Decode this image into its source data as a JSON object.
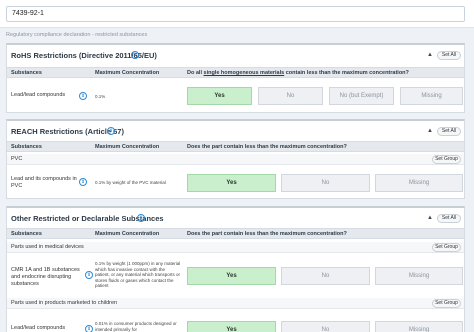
{
  "search": {
    "value": "7439-92-1"
  },
  "breadcrumb": "Regulatory compliance declaration - restricted substances",
  "rohs": {
    "title": "RoHS Restrictions (Directive 2011/65/EU)",
    "set_all": "Set All",
    "headers": {
      "substances": "Substances",
      "max_conc": "Maximum Concentration",
      "question_pre": "Do all ",
      "question_link": "single homogeneous materials",
      "question_post": " contain less than the maximum concentration?"
    },
    "row": {
      "substance": "Lead/lead compounds",
      "concentration": "0.1%"
    },
    "options": [
      "Yes",
      "No",
      "No (but Exempt)",
      "Missing"
    ]
  },
  "reach": {
    "title": "REACH Restrictions (Article 67)",
    "set_all": "Set All",
    "headers": {
      "substances": "Substances",
      "max_conc": "Maximum Concentration",
      "question": "Does the part contain less than the maximum concentration?"
    },
    "group": {
      "label": "PVC",
      "set_group": "Set Group"
    },
    "row": {
      "substance": "Lead and its compounds in PVC",
      "concentration": "0.1% by weight of the PVC material"
    },
    "options": [
      "Yes",
      "No",
      "Missing"
    ]
  },
  "other": {
    "title": "Other Restricted or Declarable Substances",
    "set_all": "Set All",
    "headers": {
      "substances": "Substances",
      "max_conc": "Maximum Concentration",
      "question": "Does the part contain less than the maximum concentration?"
    },
    "group1": {
      "label": "Parts used in medical devices",
      "set_group": "Set Group"
    },
    "row1": {
      "substance": "CMR 1A and 1B substances and endocrine disrupting substances",
      "concentration": "0.1% by weight (1 000ppm) in any material which has invasive contact with the patient, or any material which transports or stores fluids or gases which contact the patient"
    },
    "group2": {
      "label": "Parts used in products marketed to children",
      "set_group": "Set Group"
    },
    "row2": {
      "substance": "Lead/lead compounds",
      "concentration": "0.01% in consumer products designed or intended primarily for"
    },
    "options": [
      "Yes",
      "No",
      "Missing"
    ]
  },
  "colors": {
    "selected": "#c9efcc",
    "accent": "#2b8ad6"
  },
  "icons": [
    "info-icon",
    "chevron-up-icon"
  ]
}
